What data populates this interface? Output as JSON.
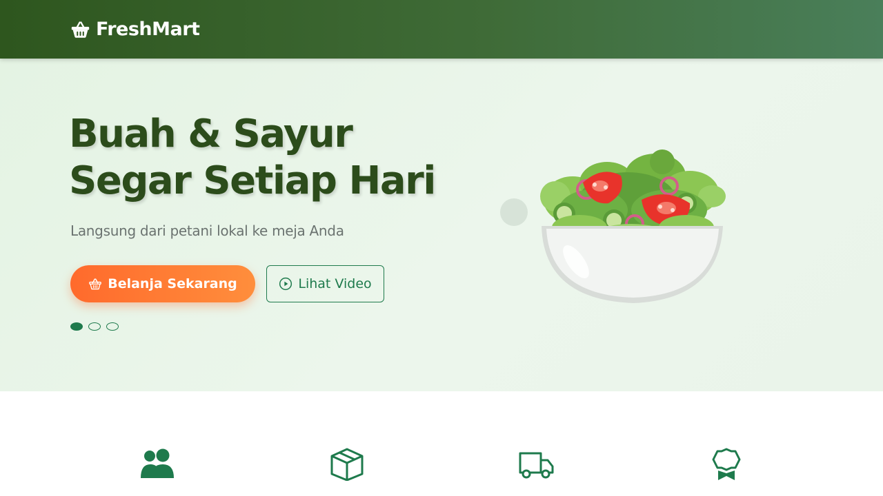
{
  "header": {
    "brand_name": "FreshMart",
    "brand_icon": "basket-icon"
  },
  "hero": {
    "title_line1": "Buah & Sayur",
    "title_line2": "Segar Setiap Hari",
    "subtitle": "Langsung dari petani lokal ke meja Anda",
    "primary_button": {
      "label": "Belanja Sekarang",
      "icon": "basket-icon"
    },
    "secondary_button": {
      "label": "Lihat Video",
      "icon": "play-circle-icon"
    },
    "slides": {
      "total": 3,
      "active_index": 0
    },
    "image": "salad-bowl-illustration"
  },
  "features": {
    "icons": [
      "users-icon",
      "box-icon",
      "truck-icon",
      "award-icon"
    ]
  },
  "colors": {
    "header_gradient_start": "#2e561e",
    "header_gradient_end": "#4a7f5a",
    "hero_background": "#e8f4e8",
    "title_color": "#2c4c1b",
    "accent_green": "#1e7a4c",
    "cta_orange_start": "#ff6a2c",
    "cta_orange_end": "#ff8e3c",
    "subtitle_gray": "#6b7370"
  }
}
